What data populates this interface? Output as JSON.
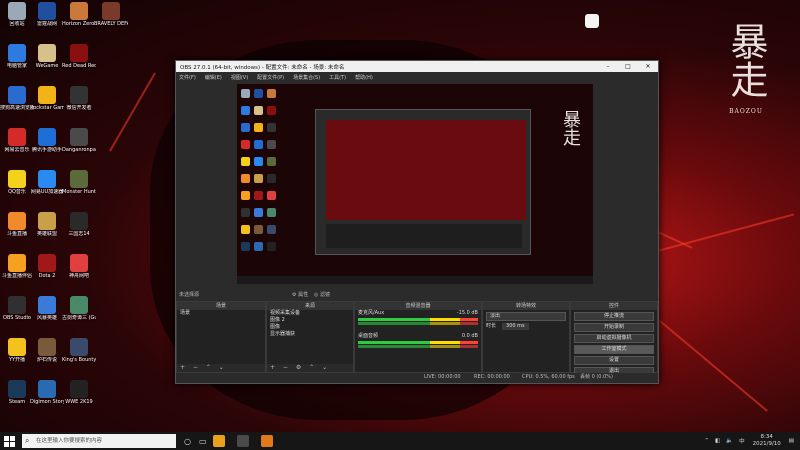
{
  "desktop": {
    "icons": [
      {
        "label": "回收站",
        "color": "#9aa8b8"
      },
      {
        "label": "雷霆战网",
        "color": "#1f4f9e"
      },
      {
        "label": "Horizon Zero Dawn",
        "color": "#c97a3a"
      },
      {
        "label": "BRAVELY DEFAULT II",
        "color": "#7a3a2a"
      },
      {
        "label": "电脑管家",
        "color": "#2d7be0"
      },
      {
        "label": "WeGame",
        "color": "#d8c08a"
      },
      {
        "label": "Red Dead Redempti...",
        "color": "#8a1010"
      },
      {
        "label": "搜狗高速浏览器",
        "color": "#2a6bd0"
      },
      {
        "label": "Rockstar Games...",
        "color": "#f2b318"
      },
      {
        "label": "微信开发者",
        "color": "#333333"
      },
      {
        "label": "网易云音乐",
        "color": "#d42a2a"
      },
      {
        "label": "腾讯手游助手",
        "color": "#1f6ed6"
      },
      {
        "label": "Danganronpa Trigger H...",
        "color": "#4a4a4a"
      },
      {
        "label": "QQ音乐",
        "color": "#f4d21c"
      },
      {
        "label": "网易UU加速器",
        "color": "#2a8af0"
      },
      {
        "label": "Monster Hunter ...",
        "color": "#5a6a3a"
      },
      {
        "label": "斗鱼直播",
        "color": "#f08a2a"
      },
      {
        "label": "英雄联盟",
        "color": "#c8a04a"
      },
      {
        "label": "三国志14",
        "color": "#2a2a2a"
      },
      {
        "label": "斗鱼直播伴侣",
        "color": "#f5a020"
      },
      {
        "label": "Dota 2",
        "color": "#a01818"
      },
      {
        "label": "神舟网吧",
        "color": "#e04040"
      },
      {
        "label": "OBS Studio",
        "color": "#303030"
      },
      {
        "label": "风暴英雄",
        "color": "#3a7ad8"
      },
      {
        "label": "古剑奇谭三 (Gujian3)",
        "color": "#4a8a6a"
      },
      {
        "label": "YY开播",
        "color": "#f4c21c"
      },
      {
        "label": "炉石传说",
        "color": "#7a5a3a"
      },
      {
        "label": "King's Bounty II",
        "color": "#3a4a6a"
      },
      {
        "label": "Steam",
        "color": "#1b3a5a"
      },
      {
        "label": "Digimon Story Cyb...",
        "color": "#2a6ab0"
      },
      {
        "label": "WWE 2K19",
        "color": "#222222"
      }
    ],
    "calligraphy": "暴走",
    "calligraphy_sub": "BAOZOU"
  },
  "obs": {
    "title": "OBS 27.0.1 (64-bit, windows) - 配置文件: 未命名 - 场景: 未命名",
    "menu": [
      "文件(F)",
      "编辑(E)",
      "视图(V)",
      "配置文件(P)",
      "场景集合(S)",
      "工具(T)",
      "帮助(H)"
    ],
    "no_source": "未选择源",
    "status_props": "属性",
    "status_filters": "滤镜",
    "docks": {
      "scenes": {
        "header": "场景",
        "items": [
          "场景"
        ]
      },
      "sources": {
        "header": "来源",
        "items": [
          "视频采集设备",
          "图像 2",
          "图像",
          "显示器捕获"
        ]
      },
      "mixer": {
        "header": "音频混音器",
        "ch1": "麦克风/Aux",
        "ch1_db": "-15.0 dB",
        "ch2": "桌面音频",
        "ch2_db": "0.0 dB"
      },
      "transitions": {
        "header": "转场特效",
        "type": "淡出",
        "duration_label": "时长",
        "duration": "300 ms"
      },
      "controls": {
        "header": "控件",
        "buttons": [
          "停止推流",
          "开始录制",
          "启动虚拟摄像机",
          "工作室模式",
          "设置",
          "退出"
        ]
      }
    },
    "footer": {
      "live": "LIVE: 00:00:00",
      "rec": "REC: 00:00:00",
      "cpu": "CPU: 0.5%, 60.00 fps",
      "dropped": "丢帧 0 (0.0%)"
    }
  },
  "taskbar": {
    "search_placeholder": "在这里输入你要搜索的内容",
    "time": "8:34",
    "date": "2021/9/10",
    "ime": "中",
    "apps": [
      {
        "color": "#e8a21c"
      },
      {
        "color": "#4a4a4a"
      },
      {
        "color": "#e07a1c"
      }
    ]
  },
  "colors": {
    "accent": "#c01818",
    "obs_bg": "#2b2b2b"
  }
}
